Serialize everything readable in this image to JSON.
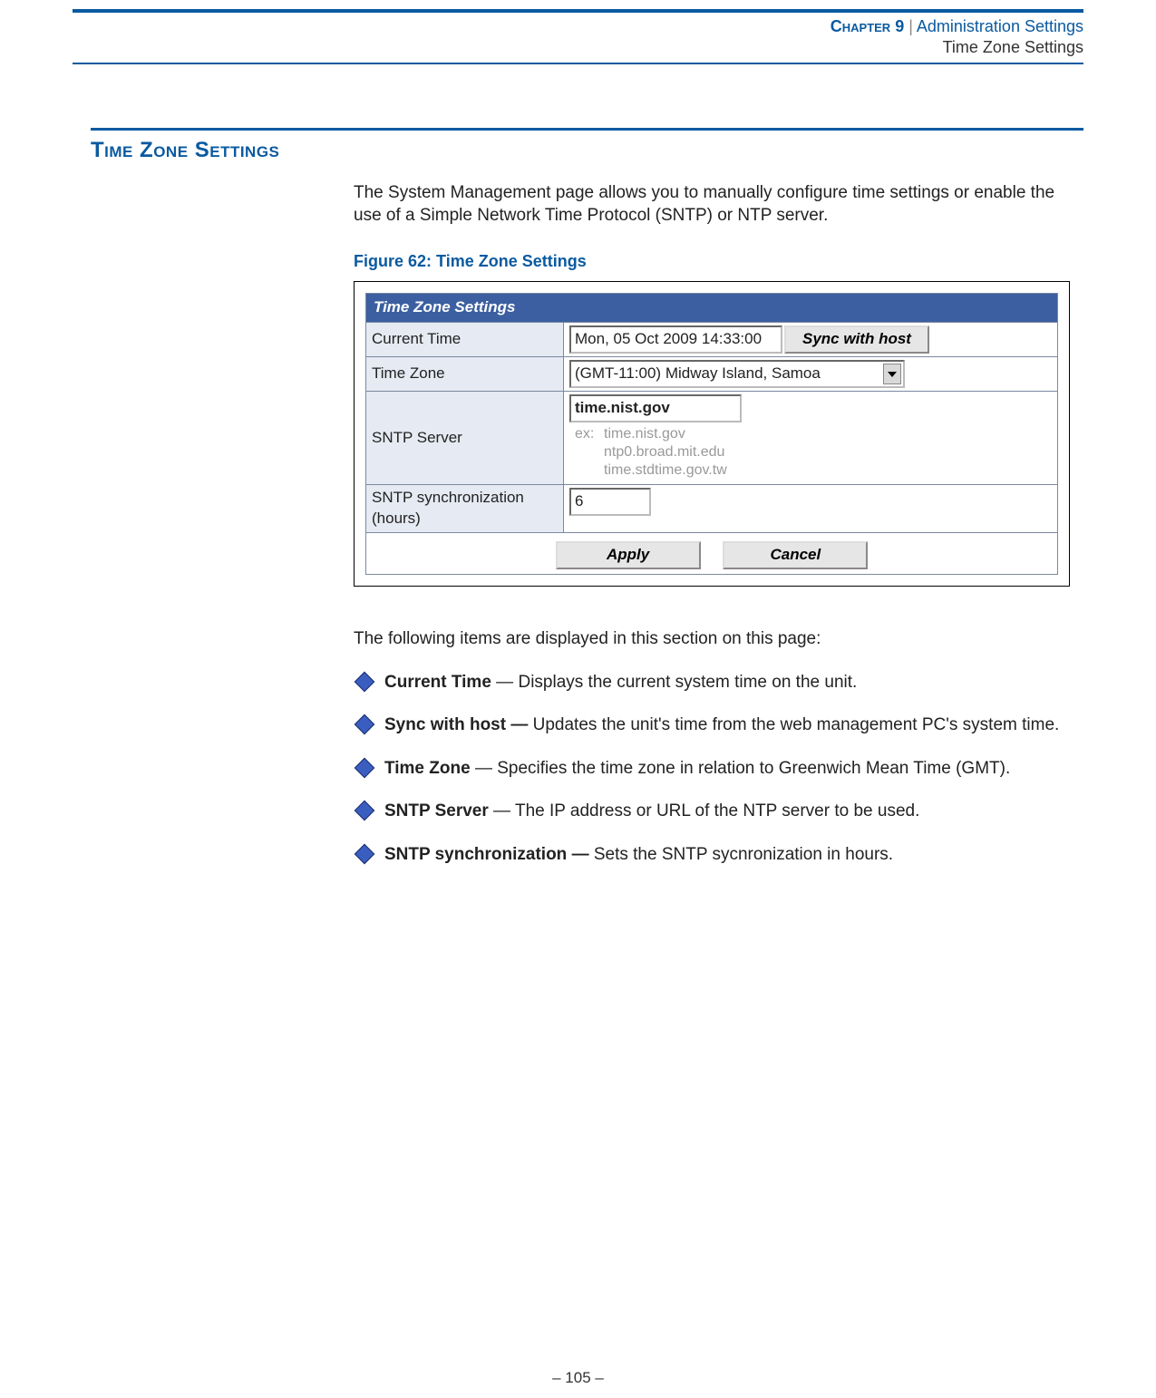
{
  "header": {
    "chapter_label": "Chapter 9",
    "separator": "  |  ",
    "crumb1": "Administration Settings",
    "crumb2": "Time Zone Settings"
  },
  "section": {
    "title": "Time Zone Settings",
    "intro": "The System Management page allows you to manually configure time settings or enable the use of a Simple Network Time Protocol (SNTP) or NTP server."
  },
  "figure": {
    "caption": "Figure 62:  Time Zone Settings"
  },
  "ui": {
    "panel_title": "Time Zone Settings",
    "rows": {
      "current_time": {
        "label": "Current Time",
        "value": "Mon, 05 Oct 2009 14:33:00",
        "sync_label": "Sync with host"
      },
      "time_zone": {
        "label": "Time Zone",
        "value": "(GMT-11:00) Midway Island, Samoa"
      },
      "sntp_server": {
        "label": "SNTP Server",
        "value": "time.nist.gov",
        "hint_prefix": "ex:",
        "hints": [
          "time.nist.gov",
          "ntp0.broad.mit.edu",
          "time.stdtime.gov.tw"
        ]
      },
      "sntp_sync": {
        "label": "SNTP synchronization (hours)",
        "value": "6"
      }
    },
    "buttons": {
      "apply": "Apply",
      "cancel": "Cancel"
    }
  },
  "list": {
    "intro": "The following items are displayed in this section on this page:",
    "items": [
      {
        "term": "Current Time",
        "sep": " — ",
        "desc": "Displays the current system time on the unit."
      },
      {
        "term": "Sync with host — ",
        "sep": "",
        "desc": "Updates the unit's time from the web management PC's system time."
      },
      {
        "term": "Time Zone",
        "sep": " — ",
        "desc": "Specifies the time zone in relation to Greenwich Mean Time (GMT)."
      },
      {
        "term": "SNTP Server",
        "sep": " — ",
        "desc": "The IP address or URL of the NTP server to be used."
      },
      {
        "term": "SNTP synchronization — ",
        "sep": "",
        "desc": "Sets the SNTP sycnronization in hours."
      }
    ]
  },
  "footer": {
    "page": "–  105  –"
  }
}
